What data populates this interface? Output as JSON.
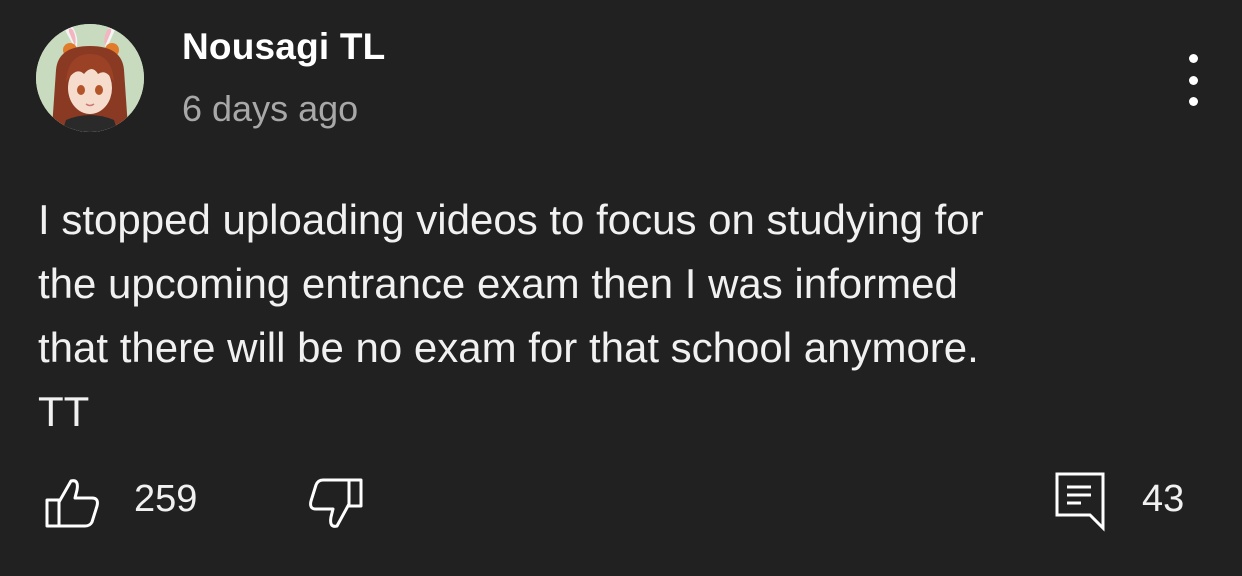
{
  "comment": {
    "author": "Nousagi TL",
    "timestamp": "6 days ago",
    "text": "I stopped uploading videos to focus on studying for\nthe upcoming entrance exam then I was informed\nthat there will be no exam for that school anymore.\nTT"
  },
  "actions": {
    "like_count": "259",
    "reply_count": "43"
  },
  "icons": {
    "avatar": "anime-avatar",
    "menu": "more-vertical-icon",
    "like": "thumbs-up-icon",
    "dislike": "thumbs-down-icon",
    "reply": "comment-icon"
  },
  "colors": {
    "background": "#212121",
    "text": "#f1f1f1",
    "secondary_text": "#a8a8a8"
  }
}
